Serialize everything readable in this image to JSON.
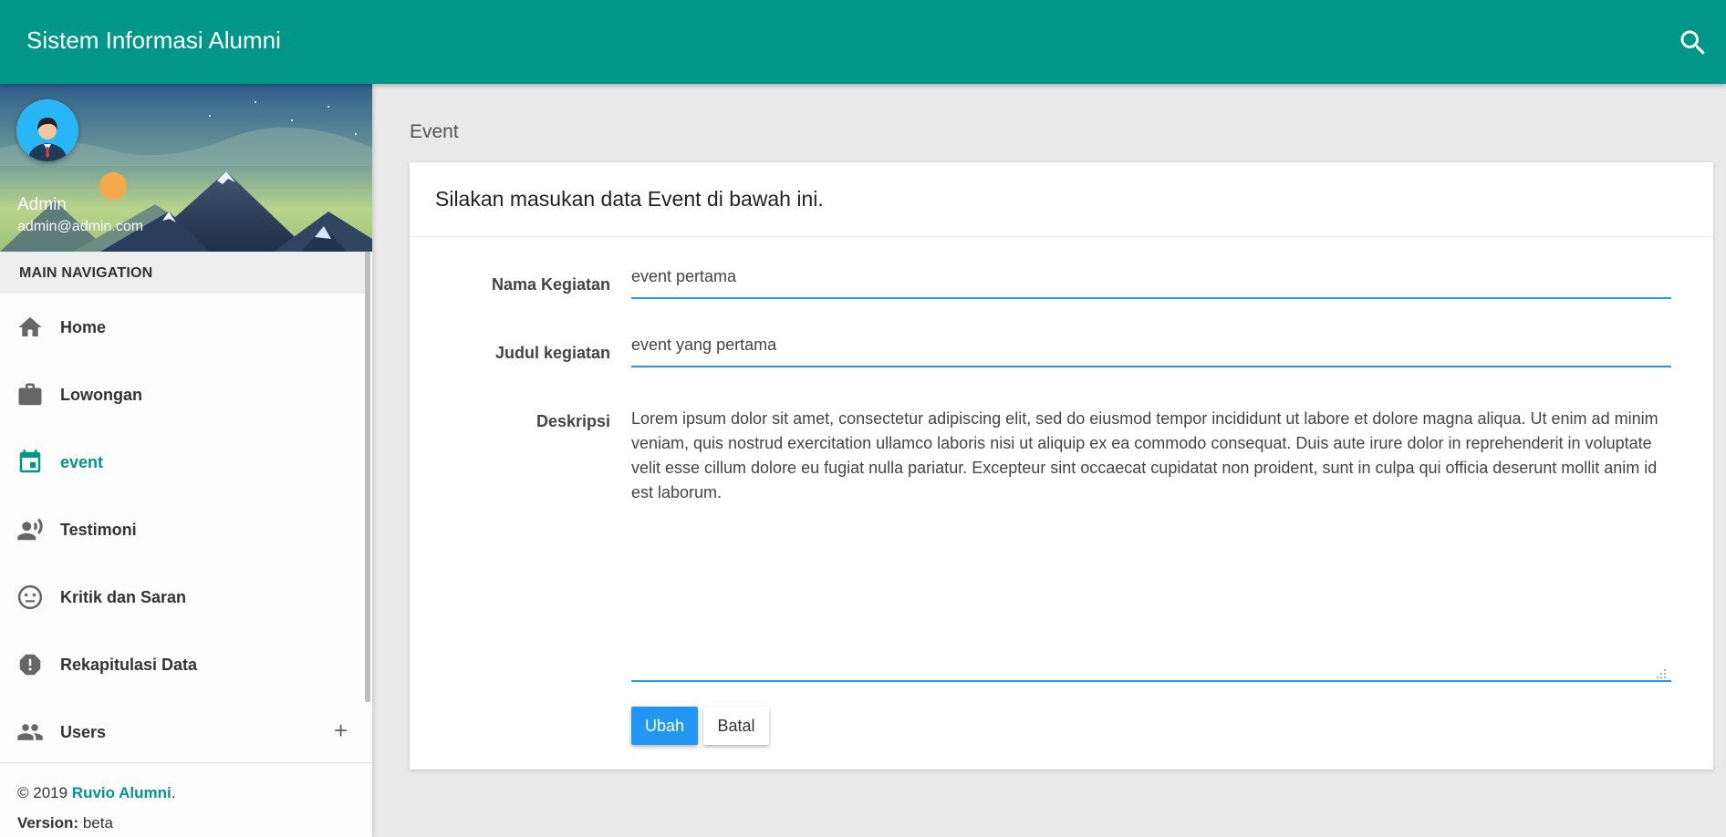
{
  "app": {
    "title": "Sistem Informasi Alumni"
  },
  "header": {
    "search_icon": "search-icon"
  },
  "user": {
    "name": "Admin",
    "email": "admin@admin.com"
  },
  "sidebar": {
    "nav_header": "MAIN NAVIGATION",
    "items": [
      {
        "label": "Home",
        "icon": "home-icon",
        "active": false
      },
      {
        "label": "Lowongan",
        "icon": "briefcase-icon",
        "active": false
      },
      {
        "label": "event",
        "icon": "calendar-icon",
        "active": true
      },
      {
        "label": "Testimoni",
        "icon": "record-voice-icon",
        "active": false
      },
      {
        "label": "Kritik dan Saran",
        "icon": "neutral-face-icon",
        "active": false
      },
      {
        "label": "Rekapitulasi Data",
        "icon": "alert-octagon-icon",
        "active": false
      },
      {
        "label": "Users",
        "icon": "people-icon",
        "active": false,
        "expand": "+"
      }
    ],
    "footer": {
      "copyright": "© 2019 ",
      "brand": "Ruvio Alumni",
      "period": ".",
      "version_label": "Version:",
      "version_value": " beta"
    }
  },
  "page": {
    "title": "Event"
  },
  "form": {
    "heading": "Silakan masukan data Event di bawah ini.",
    "nama_label": "Nama Kegiatan",
    "nama_value": "event pertama",
    "judul_label": "Judul kegiatan",
    "judul_value": "event yang pertama",
    "deskripsi_label": "Deskripsi",
    "deskripsi_value": "Lorem ipsum dolor sit amet, consectetur adipiscing elit, sed do eiusmod tempor incididunt ut labore et dolore magna aliqua. Ut enim ad minim veniam, quis nostrud exercitation ullamco laboris nisi ut aliquip ex ea commodo consequat. Duis aute irure dolor in reprehenderit in voluptate velit esse cillum dolore eu fugiat nulla pariatur. Excepteur sint occaecat cupidatat non proident, sunt in culpa qui officia deserunt mollit anim id est laborum.",
    "submit_label": "Ubah",
    "cancel_label": "Batal"
  },
  "colors": {
    "primary": "#009688",
    "accent": "#2196f3"
  }
}
